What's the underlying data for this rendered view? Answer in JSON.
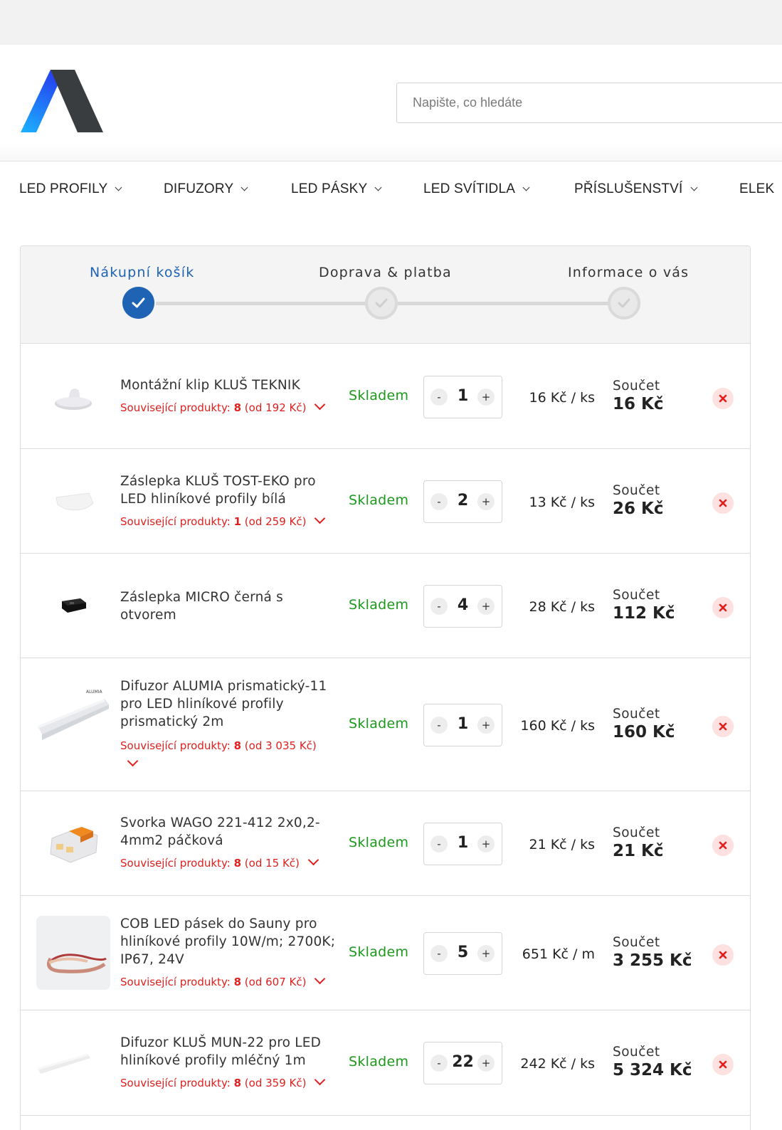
{
  "search": {
    "placeholder": "Napište, co hledáte"
  },
  "nav": [
    {
      "label": "LED PROFILY"
    },
    {
      "label": "DIFUZORY"
    },
    {
      "label": "LED PÁSKY"
    },
    {
      "label": "LED SVÍTIDLA"
    },
    {
      "label": "PŘÍSLUŠENSTVÍ"
    },
    {
      "label": "ELEK"
    }
  ],
  "steps": [
    {
      "label": "Nákupní košík",
      "state": "active"
    },
    {
      "label": "Doprava & platba",
      "state": "pending"
    },
    {
      "label": "Informace o vás",
      "state": "pending"
    }
  ],
  "colors": {
    "accent": "#1f63b5",
    "stock": "#1b9a1b",
    "related": "#e0201e",
    "remove_bg": "#fde1e1"
  },
  "cart": {
    "stock_label": "Skladem",
    "sum_label": "Součet",
    "related_prefix": "Související produkty:",
    "items": [
      {
        "name": "Montážní klip KLUŠ TEKNIK",
        "related_count": "8",
        "related_from": "(od 192 Kč)",
        "qty": "1",
        "unit_price": "16 Kč / ks",
        "sum": "16 Kč",
        "icon": "clip-thumbnail"
      },
      {
        "name": "Záslepka KLUŠ TOST-EKO pro LED hliníkové profily bílá",
        "related_count": "1",
        "related_from": "(od 259 Kč)",
        "qty": "2",
        "unit_price": "13 Kč / ks",
        "sum": "26 Kč",
        "icon": "endcap-white-thumbnail"
      },
      {
        "name": "Záslepka MICRO černá s otvorem",
        "related_count": "",
        "related_from": "",
        "qty": "4",
        "unit_price": "28 Kč / ks",
        "sum": "112 Kč",
        "icon": "endcap-black-thumbnail"
      },
      {
        "name": "Difuzor ALUMIA prismatický-11 pro LED hliníkové profily prismatický 2m",
        "related_count": "8",
        "related_from": "(od 3 035 Kč)",
        "qty": "1",
        "unit_price": "160 Kč / ks",
        "sum": "160 Kč",
        "icon": "diffuser-prismatic-thumbnail",
        "brand_text": "ALUMIA"
      },
      {
        "name": "Svorka WAGO 221-412 2x0,2-4mm2 páčková",
        "related_count": "8",
        "related_from": "(od 15 Kč)",
        "qty": "1",
        "unit_price": "21 Kč / ks",
        "sum": "21 Kč",
        "icon": "wago-connector-thumbnail"
      },
      {
        "name": "COB LED pásek do Sauny pro hliníkové profily 10W/m; 2700K; IP67, 24V",
        "related_count": "8",
        "related_from": "(od 607 Kč)",
        "qty": "5",
        "unit_price": "651 Kč / m",
        "sum": "3 255 Kč",
        "icon": "cob-strip-thumbnail"
      },
      {
        "name": "Difuzor KLUŠ MUN-22 pro LED hliníkové profily mléčný 1m",
        "related_count": "8",
        "related_from": "(od 359 Kč)",
        "qty": "22",
        "unit_price": "242 Kč / ks",
        "sum": "5 324 Kč",
        "icon": "diffuser-milky-thumbnail"
      }
    ]
  }
}
